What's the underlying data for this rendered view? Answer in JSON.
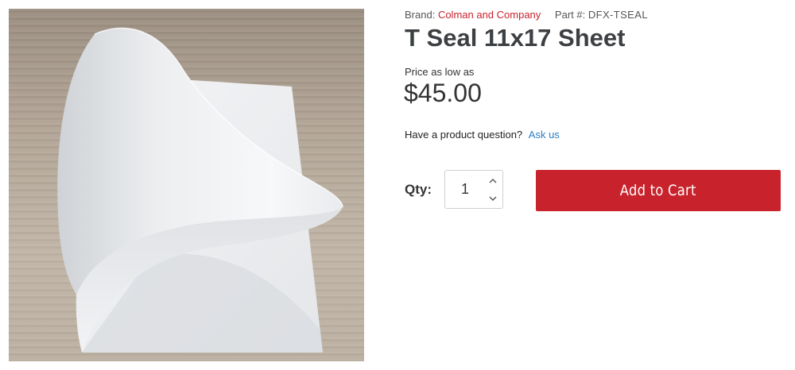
{
  "product": {
    "brand_label": "Brand:",
    "brand_name": "Colman and Company",
    "part_label": "Part #:",
    "part_number": "DFX-TSEAL",
    "title": "T Seal 11x17 Sheet",
    "image_alt": "T Seal 11x17 Sheet"
  },
  "pricing": {
    "label": "Price as low as",
    "value": "$45.00"
  },
  "question": {
    "text": "Have a product question?",
    "link": "Ask us"
  },
  "purchase": {
    "qty_label": "Qty:",
    "qty_value": "1",
    "add_to_cart": "Add to Cart"
  },
  "colors": {
    "accent": "#c8232c",
    "link": "#2a7dc4",
    "title": "#3d4043"
  },
  "icons": {
    "qty_up": "chevron-up-icon",
    "qty_down": "chevron-down-icon"
  }
}
